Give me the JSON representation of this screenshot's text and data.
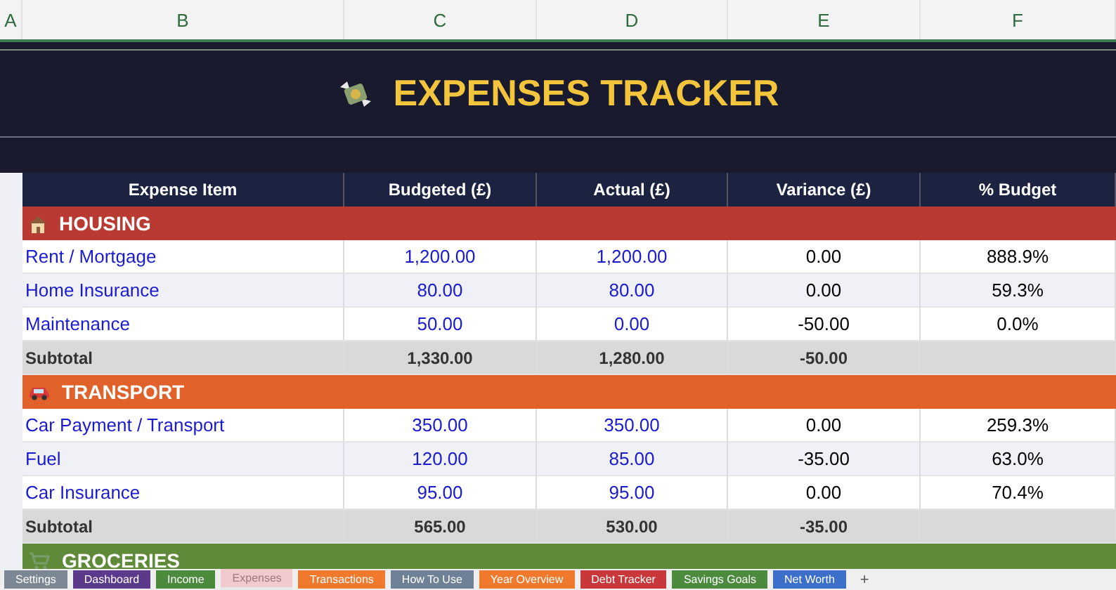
{
  "column_headers": [
    "A",
    "B",
    "C",
    "D",
    "E",
    "F"
  ],
  "title": "EXPENSES TRACKER",
  "table": {
    "columns": [
      "Expense Item",
      "Budgeted (£)",
      "Actual (£)",
      "Variance (£)",
      "% Budget"
    ],
    "sections": [
      {
        "name": "HOUSING",
        "kind": "house",
        "color": "#b93a32",
        "rows": [
          {
            "item": "Rent / Mortgage",
            "budgeted": "1,200.00",
            "actual": "1,200.00",
            "variance": "0.00",
            "percent": "888.9%"
          },
          {
            "item": "Home Insurance",
            "budgeted": "80.00",
            "actual": "80.00",
            "variance": "0.00",
            "percent": "59.3%"
          },
          {
            "item": "Maintenance",
            "budgeted": "50.00",
            "actual": "0.00",
            "variance": "-50.00",
            "percent": "0.0%"
          }
        ],
        "subtotal": {
          "label": "Subtotal",
          "budgeted": "1,330.00",
          "actual": "1,280.00",
          "variance": "-50.00"
        }
      },
      {
        "name": "TRANSPORT",
        "kind": "car",
        "color": "#e0622a",
        "rows": [
          {
            "item": "Car Payment / Transport",
            "budgeted": "350.00",
            "actual": "350.00",
            "variance": "0.00",
            "percent": "259.3%"
          },
          {
            "item": "Fuel",
            "budgeted": "120.00",
            "actual": "85.00",
            "variance": "-35.00",
            "percent": "63.0%"
          },
          {
            "item": "Car Insurance",
            "budgeted": "95.00",
            "actual": "95.00",
            "variance": "0.00",
            "percent": "70.4%"
          }
        ],
        "subtotal": {
          "label": "Subtotal",
          "budgeted": "565.00",
          "actual": "530.00",
          "variance": "-35.00"
        }
      },
      {
        "name": "GROCERIES",
        "kind": "cart",
        "color": "#5e8a3a"
      }
    ]
  },
  "sheet_tabs": [
    {
      "label": "Settings",
      "color": "#7b8793",
      "selected": false
    },
    {
      "label": "Dashboard",
      "color": "#5b3a8c",
      "selected": false
    },
    {
      "label": "Income",
      "color": "#4c8a3e",
      "selected": false
    },
    {
      "label": "Expenses",
      "color": "#f2c9cc",
      "selected": true
    },
    {
      "label": "Transactions",
      "color": "#ef7a2e",
      "selected": false
    },
    {
      "label": "How To Use",
      "color": "#6f8196",
      "selected": false
    },
    {
      "label": "Year Overview",
      "color": "#ef7a2e",
      "selected": false
    },
    {
      "label": "Debt Tracker",
      "color": "#c8373a",
      "selected": false
    },
    {
      "label": "Savings Goals",
      "color": "#4c8a3e",
      "selected": false
    },
    {
      "label": "Net Worth",
      "color": "#3b6fc9",
      "selected": false
    }
  ],
  "add_tab": "+"
}
